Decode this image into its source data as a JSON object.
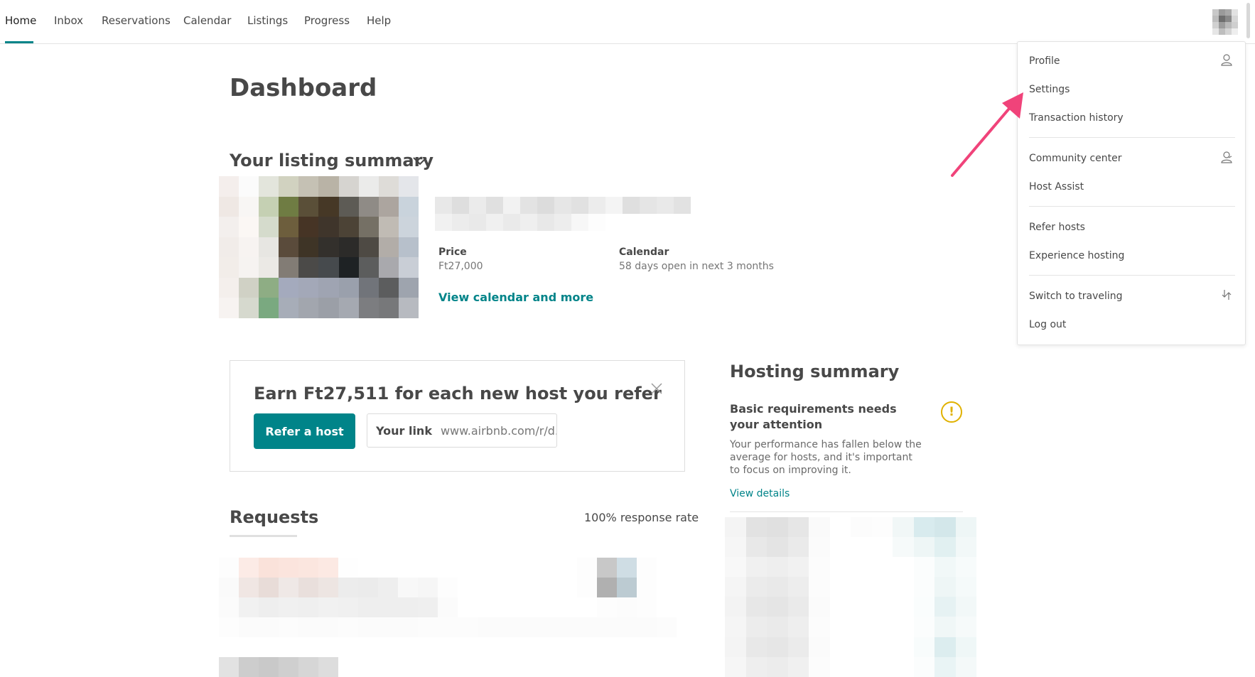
{
  "nav": {
    "items": [
      "Home",
      "Inbox",
      "Reservations",
      "Calendar",
      "Listings",
      "Progress",
      "Help"
    ],
    "active": "Home"
  },
  "dashboard": {
    "title": "Dashboard",
    "listing_summary_heading": "Your listing summary",
    "price_label": "Price",
    "price_value": "Ft27,000",
    "calendar_label": "Calendar",
    "calendar_value": "58 days open in next 3 months",
    "view_calendar_link": "View calendar and more"
  },
  "refer": {
    "title": "Earn Ft27,511 for each new host you refer",
    "button": "Refer a host",
    "link_label": "Your link",
    "link_value": "www.airbnb.com/r/d..."
  },
  "hosting_summary": {
    "title": "Hosting summary",
    "subtitle": "Basic requirements needs your attention",
    "body": "Your performance has fallen below the average for hosts, and it's important to focus on improving it.",
    "link": "View details",
    "warning_glyph": "!"
  },
  "requests": {
    "title": "Requests",
    "response_rate": "100% response rate"
  },
  "menu": {
    "items": [
      {
        "label": "Profile",
        "icon": "person-icon"
      },
      {
        "label": "Settings"
      },
      {
        "label": "Transaction history"
      },
      {
        "label": "Community center",
        "icon": "community-icon"
      },
      {
        "label": "Host Assist"
      },
      {
        "label": "Refer hosts"
      },
      {
        "label": "Experience hosting"
      },
      {
        "label": "Switch to traveling",
        "icon": "switch-icon"
      },
      {
        "label": "Log out"
      }
    ]
  },
  "colors": {
    "accent": "#008489",
    "annotation_arrow": "#f0437a",
    "warning": "#e0b100"
  }
}
